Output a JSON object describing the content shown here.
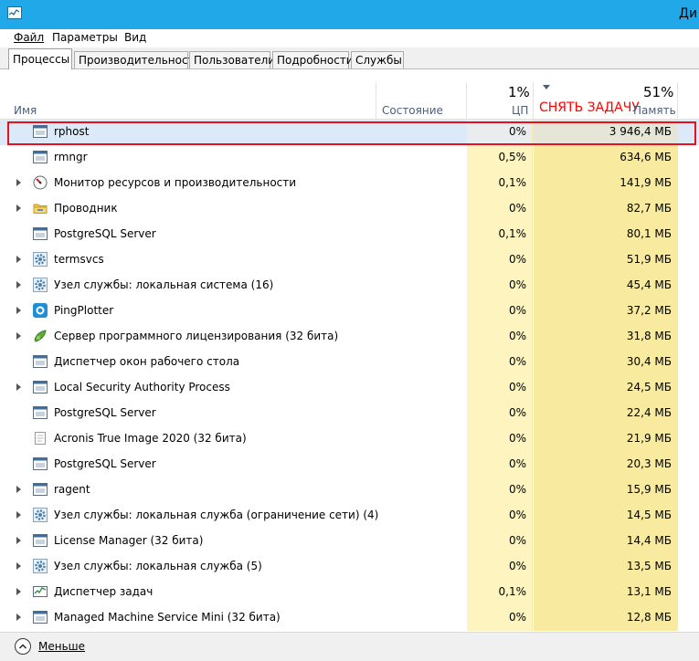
{
  "window": {
    "title": "Ди"
  },
  "menu": [
    "Файл",
    "Параметры",
    "Вид"
  ],
  "tabs": [
    {
      "label": "Процессы",
      "active": true
    },
    {
      "label": "Производительность",
      "active": false
    },
    {
      "label": "Пользователи",
      "active": false
    },
    {
      "label": "Подробности",
      "active": false
    },
    {
      "label": "Службы",
      "active": false
    }
  ],
  "columns": {
    "name": "Имя",
    "status": "Состояние",
    "cpu_pct": "1%",
    "cpu": "ЦП",
    "mem_pct": "51%",
    "mem": "Память",
    "end_task": "СНЯТЬ ЗАДАЧУ"
  },
  "rows": [
    {
      "name": "rphost",
      "cpu": "0%",
      "mem": "3 946,4 МБ",
      "expandable": false,
      "icon": "app-window-icon",
      "selected": true
    },
    {
      "name": "rmngr",
      "cpu": "0,5%",
      "mem": "634,6 МБ",
      "expandable": false,
      "icon": "app-window-icon"
    },
    {
      "name": "Монитор ресурсов и производительности",
      "cpu": "0,1%",
      "mem": "141,9 МБ",
      "expandable": true,
      "icon": "resource-monitor-icon"
    },
    {
      "name": "Проводник",
      "cpu": "0%",
      "mem": "82,7 МБ",
      "expandable": true,
      "icon": "folder-icon"
    },
    {
      "name": "PostgreSQL Server",
      "cpu": "0,1%",
      "mem": "80,1 МБ",
      "expandable": false,
      "icon": "app-window-icon"
    },
    {
      "name": "termsvcs",
      "cpu": "0%",
      "mem": "51,9 МБ",
      "expandable": true,
      "icon": "gear-icon"
    },
    {
      "name": "Узел службы: локальная система (16)",
      "cpu": "0%",
      "mem": "45,4 МБ",
      "expandable": true,
      "icon": "gear-icon"
    },
    {
      "name": "PingPlotter",
      "cpu": "0%",
      "mem": "37,2 МБ",
      "expandable": true,
      "icon": "pingplotter-icon"
    },
    {
      "name": "Сервер программного лицензирования (32 бита)",
      "cpu": "0%",
      "mem": "31,8 МБ",
      "expandable": true,
      "icon": "license-server-icon"
    },
    {
      "name": "Диспетчер окон рабочего стола",
      "cpu": "0%",
      "mem": "30,4 МБ",
      "expandable": false,
      "icon": "app-window-icon"
    },
    {
      "name": "Local Security Authority Process",
      "cpu": "0%",
      "mem": "24,5 МБ",
      "expandable": true,
      "icon": "app-window-icon"
    },
    {
      "name": "PostgreSQL Server",
      "cpu": "0%",
      "mem": "22,4 МБ",
      "expandable": false,
      "icon": "app-window-icon"
    },
    {
      "name": "Acronis True Image 2020 (32 бита)",
      "cpu": "0%",
      "mem": "21,9 МБ",
      "expandable": false,
      "icon": "generic-app-icon"
    },
    {
      "name": "PostgreSQL Server",
      "cpu": "0%",
      "mem": "20,3 МБ",
      "expandable": false,
      "icon": "app-window-icon"
    },
    {
      "name": "ragent",
      "cpu": "0%",
      "mem": "15,9 МБ",
      "expandable": true,
      "icon": "app-window-icon"
    },
    {
      "name": "Узел службы: локальная служба (ограничение сети) (4)",
      "cpu": "0%",
      "mem": "14,5 МБ",
      "expandable": true,
      "icon": "gear-icon"
    },
    {
      "name": "License Manager (32 бита)",
      "cpu": "0%",
      "mem": "14,4 МБ",
      "expandable": true,
      "icon": "app-window-icon"
    },
    {
      "name": "Узел службы: локальная служба (5)",
      "cpu": "0%",
      "mem": "13,5 МБ",
      "expandable": true,
      "icon": "gear-icon"
    },
    {
      "name": "Диспетчер задач",
      "cpu": "0,1%",
      "mem": "13,1 МБ",
      "expandable": true,
      "icon": "task-manager-icon"
    },
    {
      "name": "Managed Machine Service Mini (32 бита)",
      "cpu": "0%",
      "mem": "12,8 МБ",
      "expandable": true,
      "icon": "app-window-icon"
    }
  ],
  "footer": {
    "less_label": "Меньше"
  },
  "colors": {
    "titlebar": "#20a8e8",
    "cpu_heat": "#fdf4bf",
    "mem_heat": "#f8ea9f",
    "selection": "#dbe9f8",
    "highlight": "#e8101d"
  }
}
